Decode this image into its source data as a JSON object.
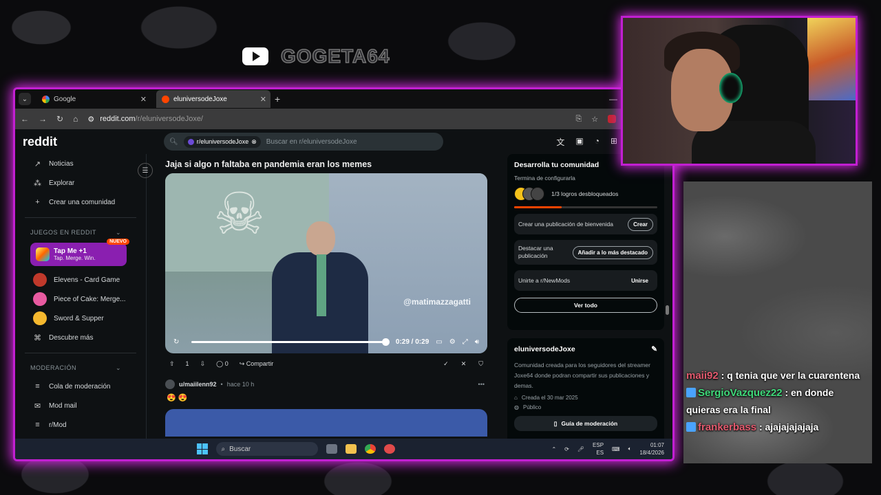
{
  "stream": {
    "yt_handle": "GOGETA64"
  },
  "browser": {
    "tabs": [
      {
        "label": "Google",
        "icon": "google-icon"
      },
      {
        "label": "eluniversodeJoxe",
        "icon": "reddit-icon"
      }
    ],
    "url_host": "reddit.com",
    "url_path": "/r/eluniversodeJoxe/"
  },
  "reddit": {
    "logo": "reddit",
    "search": {
      "chip": "r/eluniversodeJoxe",
      "placeholder": "Buscar en r/eluniversodeJoxe"
    },
    "sidebar": {
      "nav": [
        {
          "label": "Noticias",
          "icon": "trending-icon"
        },
        {
          "label": "Explorar",
          "icon": "explore-icon"
        },
        {
          "label": "Crear una comunidad",
          "icon": "plus-icon"
        }
      ],
      "games_header": "JUEGOS EN REDDIT",
      "featured_game": {
        "title": "Tap Me +1",
        "subtitle": "Tap. Merge. Win.",
        "badge": "NUEVO"
      },
      "games": [
        {
          "label": "Elevens - Card Game",
          "color": "#c0392b"
        },
        {
          "label": "Piece of Cake: Merge...",
          "color": "#e85aa0"
        },
        {
          "label": "Sword & Supper",
          "color": "#f5b82e"
        },
        {
          "label": "Descubre más",
          "color": ""
        }
      ],
      "mod_header": "MODERACIÓN",
      "mod_items": [
        {
          "label": "Cola de moderación"
        },
        {
          "label": "Mod mail"
        },
        {
          "label": "r/Mod"
        }
      ]
    },
    "post": {
      "title": "Jaja si algo n faltaba en pandemia eran los memes",
      "watermark": "@matimazzagatti",
      "time": "0:29 / 0:29",
      "votes": "1",
      "comments": "0",
      "share_label": "Compartir",
      "progress": 1.0
    },
    "post2": {
      "user": "u/maiilenn92",
      "age": "hace 10 h",
      "emoji": "😍 😍"
    },
    "community_card": {
      "title": "Desarrolla tu comunidad",
      "subtitle": "Termina de configurarla",
      "achievements": "1/3 logros desbloqueados",
      "progress": 0.33,
      "tasks": [
        {
          "text": "Crear una publicación de bienvenida",
          "action": "Crear"
        },
        {
          "text": "Destacar una publicación",
          "action": "Añadir a lo más destacado"
        },
        {
          "text": "Unirte a r/NewMods",
          "action": "Unirse"
        }
      ],
      "see_all": "Ver todo"
    },
    "about": {
      "name": "eluniversodeJoxe",
      "description": "Comunidad creada para los seguidores del streamer Joxe64 donde podran compartir sus publicaciones y demas.",
      "created": "Creada el 30 mar 2025",
      "visibility": "Público",
      "mod_guide": "Guía de moderación"
    }
  },
  "taskbar": {
    "search": "Buscar",
    "lang": "ESP",
    "lang2": "ES",
    "time": "01:07",
    "date": "18/4/2026"
  },
  "chat": [
    {
      "user": "maii92",
      "text": ": q tenia que ver la cuarentena",
      "color": "#e35a6e",
      "badge": false
    },
    {
      "user": "SergioVazquez22",
      "text": ": en donde quieras era la final",
      "color": "#3fd97a",
      "badge": true
    },
    {
      "user": "frankerbass",
      "text": ": ajajajajajaja",
      "color": "#e35a6e",
      "badge": true
    }
  ]
}
